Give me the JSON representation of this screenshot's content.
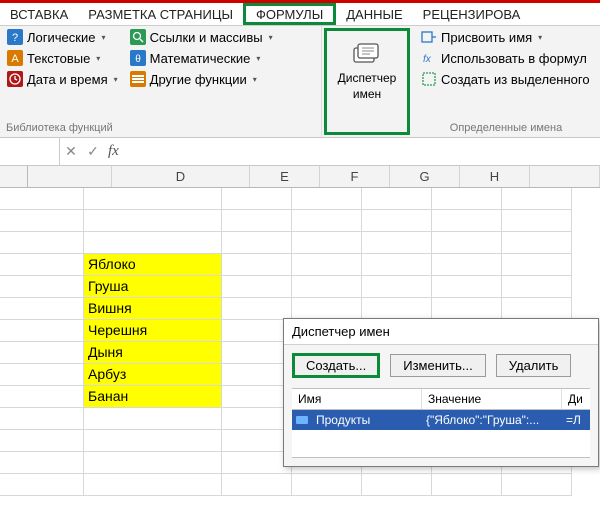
{
  "tabs": {
    "insert": "ВСТАВКА",
    "page_layout": "РАЗМЕТКА СТРАНИЦЫ",
    "formulas": "ФОРМУЛЫ",
    "data": "ДАННЫЕ",
    "review": "РЕЦЕНЗИРОВА"
  },
  "ribbon": {
    "lib": {
      "logical": "Логические",
      "text": "Текстовые",
      "datetime": "Дата и время",
      "lookup": "Ссылки и массивы",
      "math": "Математические",
      "more": "Другие функции",
      "group_title": "Библиотека функций"
    },
    "name_mgr": {
      "label_line1": "Диспетчер",
      "label_line2": "имен"
    },
    "defined": {
      "assign": "Присвоить имя",
      "use": "Использовать в формул",
      "create": "Создать из выделенного",
      "group_title": "Определенные имена"
    }
  },
  "fx": {
    "symbol": "fx",
    "cancel": "✕",
    "enter": "✓"
  },
  "cols": {
    "D": "D",
    "E": "E",
    "F": "F",
    "G": "G",
    "H": "H"
  },
  "cells": {
    "items": [
      "Яблоко",
      "Груша",
      "Вишня",
      "Черешня",
      "Дыня",
      "Арбуз",
      "Банан"
    ]
  },
  "dialog": {
    "title": "Диспетчер имен",
    "create": "Создать...",
    "edit": "Изменить...",
    "delete": "Удалить",
    "col_name": "Имя",
    "col_value": "Значение",
    "col_ref": "Ди",
    "row_name": "Продукты",
    "row_value": "{\"Яблоко\":\"Груша\":...",
    "row_ref": "=Л"
  }
}
